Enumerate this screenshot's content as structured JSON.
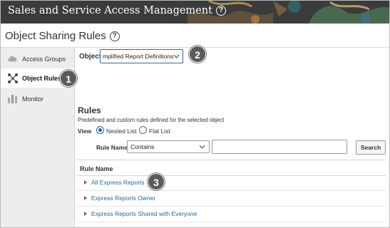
{
  "header": {
    "title": "Sales and Service Access Management",
    "help_icon": "help-circle-icon"
  },
  "page": {
    "title": "Object Sharing Rules",
    "help_icon": "help-circle-icon"
  },
  "sidebar": {
    "items": [
      {
        "label": "Access Groups",
        "icon": "cloud-group-icon",
        "active": false
      },
      {
        "label": "Object Rules",
        "icon": "network-nodes-icon",
        "active": true
      },
      {
        "label": "Monitor",
        "icon": "bar-chart-icon",
        "active": false
      }
    ]
  },
  "object": {
    "label": "Object",
    "selected": "mplified Report Definitions"
  },
  "rules": {
    "heading": "Rules",
    "description": "Predefined and custom rules defined for the selected object",
    "view_label": "View",
    "view_options": [
      {
        "label": "Nested List",
        "checked": true
      },
      {
        "label": "Flat List",
        "checked": false
      }
    ],
    "rule_name_label": "Rule Name",
    "operator": "Contains",
    "search_value": "",
    "search_button": "Search"
  },
  "table": {
    "column_header": "Rule Name",
    "rows": [
      {
        "name": "All Express Reports"
      },
      {
        "name": "Express Reports Owner"
      },
      {
        "name": "Express Reports Shared with Everyone"
      }
    ]
  },
  "callouts": [
    "1",
    "2",
    "3"
  ],
  "colors": {
    "header_bg": "#3b3b3b",
    "link": "#1f6aa5",
    "focus_border": "#2b6cb0",
    "sidebar_bg": "#ededed",
    "callout_bg": "#5b5b5b"
  }
}
